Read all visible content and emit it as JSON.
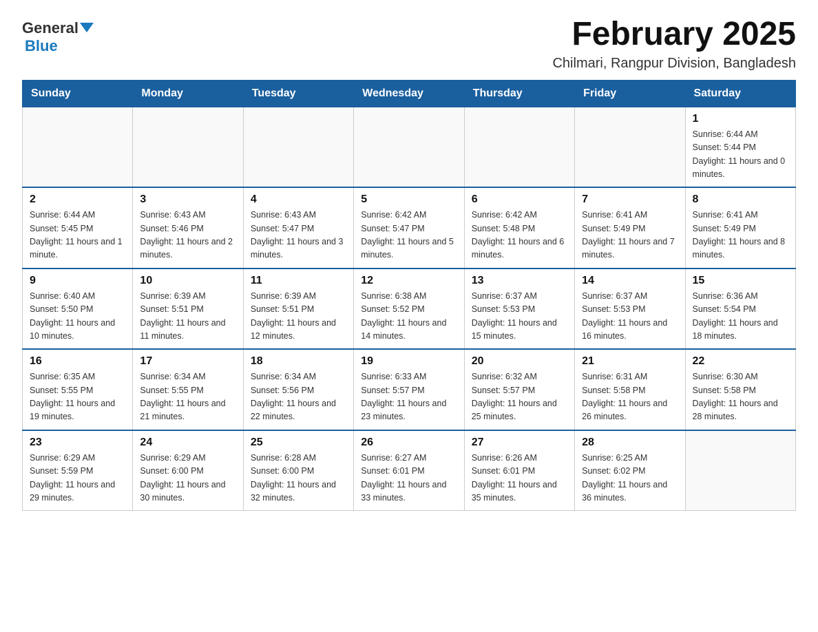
{
  "header": {
    "logo_general": "General",
    "logo_blue": "Blue",
    "month_title": "February 2025",
    "location": "Chilmari, Rangpur Division, Bangladesh"
  },
  "days_of_week": [
    "Sunday",
    "Monday",
    "Tuesday",
    "Wednesday",
    "Thursday",
    "Friday",
    "Saturday"
  ],
  "weeks": [
    [
      {
        "day": "",
        "info": ""
      },
      {
        "day": "",
        "info": ""
      },
      {
        "day": "",
        "info": ""
      },
      {
        "day": "",
        "info": ""
      },
      {
        "day": "",
        "info": ""
      },
      {
        "day": "",
        "info": ""
      },
      {
        "day": "1",
        "info": "Sunrise: 6:44 AM\nSunset: 5:44 PM\nDaylight: 11 hours and 0 minutes."
      }
    ],
    [
      {
        "day": "2",
        "info": "Sunrise: 6:44 AM\nSunset: 5:45 PM\nDaylight: 11 hours and 1 minute."
      },
      {
        "day": "3",
        "info": "Sunrise: 6:43 AM\nSunset: 5:46 PM\nDaylight: 11 hours and 2 minutes."
      },
      {
        "day": "4",
        "info": "Sunrise: 6:43 AM\nSunset: 5:47 PM\nDaylight: 11 hours and 3 minutes."
      },
      {
        "day": "5",
        "info": "Sunrise: 6:42 AM\nSunset: 5:47 PM\nDaylight: 11 hours and 5 minutes."
      },
      {
        "day": "6",
        "info": "Sunrise: 6:42 AM\nSunset: 5:48 PM\nDaylight: 11 hours and 6 minutes."
      },
      {
        "day": "7",
        "info": "Sunrise: 6:41 AM\nSunset: 5:49 PM\nDaylight: 11 hours and 7 minutes."
      },
      {
        "day": "8",
        "info": "Sunrise: 6:41 AM\nSunset: 5:49 PM\nDaylight: 11 hours and 8 minutes."
      }
    ],
    [
      {
        "day": "9",
        "info": "Sunrise: 6:40 AM\nSunset: 5:50 PM\nDaylight: 11 hours and 10 minutes."
      },
      {
        "day": "10",
        "info": "Sunrise: 6:39 AM\nSunset: 5:51 PM\nDaylight: 11 hours and 11 minutes."
      },
      {
        "day": "11",
        "info": "Sunrise: 6:39 AM\nSunset: 5:51 PM\nDaylight: 11 hours and 12 minutes."
      },
      {
        "day": "12",
        "info": "Sunrise: 6:38 AM\nSunset: 5:52 PM\nDaylight: 11 hours and 14 minutes."
      },
      {
        "day": "13",
        "info": "Sunrise: 6:37 AM\nSunset: 5:53 PM\nDaylight: 11 hours and 15 minutes."
      },
      {
        "day": "14",
        "info": "Sunrise: 6:37 AM\nSunset: 5:53 PM\nDaylight: 11 hours and 16 minutes."
      },
      {
        "day": "15",
        "info": "Sunrise: 6:36 AM\nSunset: 5:54 PM\nDaylight: 11 hours and 18 minutes."
      }
    ],
    [
      {
        "day": "16",
        "info": "Sunrise: 6:35 AM\nSunset: 5:55 PM\nDaylight: 11 hours and 19 minutes."
      },
      {
        "day": "17",
        "info": "Sunrise: 6:34 AM\nSunset: 5:55 PM\nDaylight: 11 hours and 21 minutes."
      },
      {
        "day": "18",
        "info": "Sunrise: 6:34 AM\nSunset: 5:56 PM\nDaylight: 11 hours and 22 minutes."
      },
      {
        "day": "19",
        "info": "Sunrise: 6:33 AM\nSunset: 5:57 PM\nDaylight: 11 hours and 23 minutes."
      },
      {
        "day": "20",
        "info": "Sunrise: 6:32 AM\nSunset: 5:57 PM\nDaylight: 11 hours and 25 minutes."
      },
      {
        "day": "21",
        "info": "Sunrise: 6:31 AM\nSunset: 5:58 PM\nDaylight: 11 hours and 26 minutes."
      },
      {
        "day": "22",
        "info": "Sunrise: 6:30 AM\nSunset: 5:58 PM\nDaylight: 11 hours and 28 minutes."
      }
    ],
    [
      {
        "day": "23",
        "info": "Sunrise: 6:29 AM\nSunset: 5:59 PM\nDaylight: 11 hours and 29 minutes."
      },
      {
        "day": "24",
        "info": "Sunrise: 6:29 AM\nSunset: 6:00 PM\nDaylight: 11 hours and 30 minutes."
      },
      {
        "day": "25",
        "info": "Sunrise: 6:28 AM\nSunset: 6:00 PM\nDaylight: 11 hours and 32 minutes."
      },
      {
        "day": "26",
        "info": "Sunrise: 6:27 AM\nSunset: 6:01 PM\nDaylight: 11 hours and 33 minutes."
      },
      {
        "day": "27",
        "info": "Sunrise: 6:26 AM\nSunset: 6:01 PM\nDaylight: 11 hours and 35 minutes."
      },
      {
        "day": "28",
        "info": "Sunrise: 6:25 AM\nSunset: 6:02 PM\nDaylight: 11 hours and 36 minutes."
      },
      {
        "day": "",
        "info": ""
      }
    ]
  ]
}
